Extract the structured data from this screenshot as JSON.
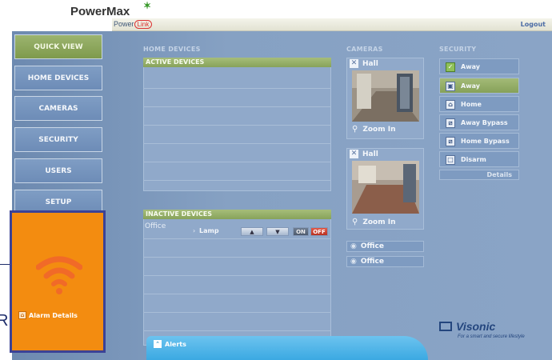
{
  "brand": {
    "name": "PowerMax",
    "link_product": "PowerLink",
    "link_badge": "Link"
  },
  "header": {
    "logout_label": "Logout"
  },
  "nav": [
    {
      "label": "QUICK VIEW"
    },
    {
      "label": "HOME DEVICES"
    },
    {
      "label": "CAMERAS"
    },
    {
      "label": "SECURITY"
    },
    {
      "label": "USERS"
    },
    {
      "label": "SETUP"
    }
  ],
  "home_devices": {
    "title": "HOME DEVICES",
    "active_header": "ACTIVE DEVICES",
    "inactive_header": "INACTIVE DEVICES",
    "inactive_rows": [
      {
        "location": "Office",
        "device": "Lamp",
        "on_label": "ON",
        "off_label": "OFF"
      }
    ]
  },
  "cameras": {
    "title": "CAMERAS",
    "items": [
      {
        "name": "Hall",
        "zoom_label": "Zoom In"
      },
      {
        "name": "Hall",
        "zoom_label": "Zoom In"
      }
    ],
    "offline": [
      "Office",
      "Office"
    ]
  },
  "security": {
    "title": "SECURITY",
    "status": "Away",
    "options": [
      "Away",
      "Home",
      "Away Bypass",
      "Home Bypass",
      "Disarm"
    ],
    "details_label": "Details"
  },
  "alarm": {
    "details_label": "Alarm Details"
  },
  "alerts": {
    "label": "Alerts"
  },
  "footer": {
    "company": "Visonic",
    "tagline": "For a smart and secure lifestyle"
  },
  "stray_text": "R",
  "colors": {
    "panel": "#7f9cc2",
    "accent_green": "#8aa55c",
    "alarm_orange": "#f38c10",
    "alarm_border": "#3b4296",
    "alerts_blue": "#4ab2e6"
  }
}
